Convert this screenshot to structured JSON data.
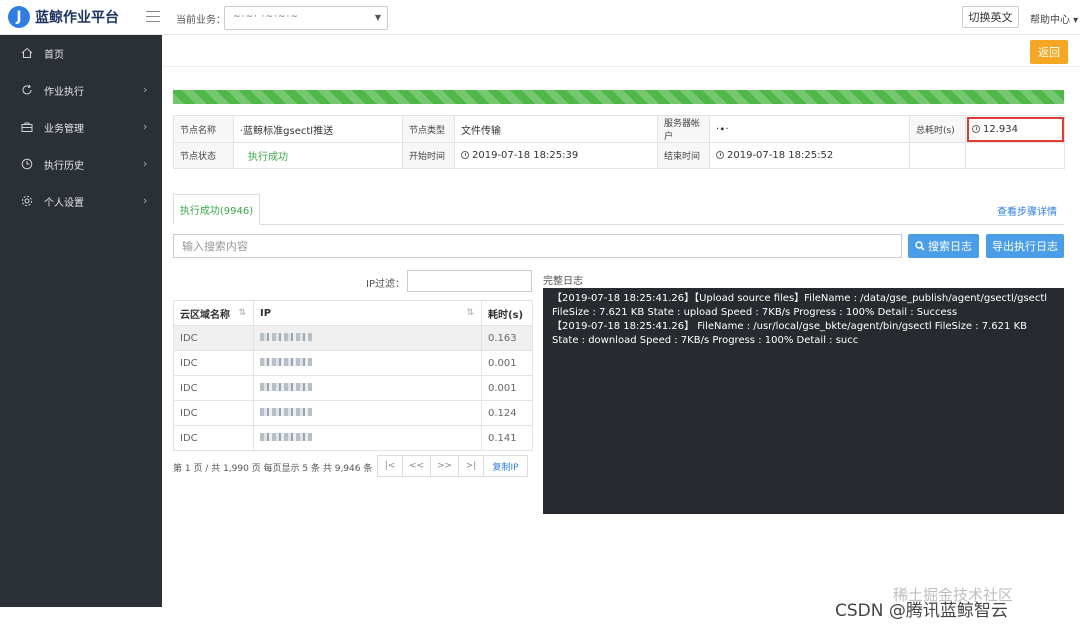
{
  "app": {
    "logo_letter": "J",
    "title": "蓝鲸作业平台"
  },
  "topbar": {
    "business_label": "当前业务：",
    "business_value": "~·~· ·~·~·~",
    "lang_button": "切换英文",
    "help": "帮助中心 ▾"
  },
  "sidebar": {
    "items": [
      {
        "label": "首页",
        "icon": "home-icon",
        "has_arrow": false
      },
      {
        "label": "作业执行",
        "icon": "refresh-icon",
        "has_arrow": true
      },
      {
        "label": "业务管理",
        "icon": "briefcase-icon",
        "has_arrow": true
      },
      {
        "label": "执行历史",
        "icon": "clock-icon",
        "has_arrow": true
      },
      {
        "label": "个人设置",
        "icon": "gear-icon",
        "has_arrow": true
      }
    ],
    "arrow": "›"
  },
  "main": {
    "back_button": "返回",
    "progress": 1.0,
    "info": {
      "node_name_label": "节点名称",
      "node_name_value": "·蓝鲸标准gsectl推送",
      "node_type_label": "节点类型",
      "node_type_value": "文件传输",
      "server_account_label": "服务器帐户",
      "server_account_value": "·∙·",
      "total_time_label": "总耗时(s)",
      "total_time_value": "12.934",
      "node_status_label": "节点状态",
      "node_status_value": "执行成功",
      "start_time_label": "开始时间",
      "start_time_value": "2019-07-18 18:25:39",
      "end_time_label": "结束时间",
      "end_time_value": "2019-07-18 18:25:52"
    },
    "tab_label": "执行成功(9946)",
    "view_steps_link": "查看步骤详情",
    "search_placeholder": "输入搜索内容",
    "search_button": "搜索日志",
    "export_button": "导出执行日志",
    "ip_filter_label": "IP过滤：",
    "hosts_table": {
      "columns": [
        "云区域名称",
        "IP",
        "耗时(s)"
      ],
      "rows": [
        {
          "zone": "IDC",
          "time": "0.163"
        },
        {
          "zone": "IDC",
          "time": "0.001"
        },
        {
          "zone": "IDC",
          "time": "0.001"
        },
        {
          "zone": "IDC",
          "time": "0.124"
        },
        {
          "zone": "IDC",
          "time": "0.141"
        }
      ]
    },
    "pager_info": "第 1 页 / 共 1,990 页  每页显示 5 条  共 9,946 条",
    "pager_buttons": [
      "|<",
      "<<",
      ">>",
      ">|",
      "复制IP"
    ],
    "log_title": "完整日志",
    "log_lines": [
      "【2019-07-18 18:25:41.26】【Upload source files】FileName : /data/gse_publish/agent/gsectl/gsectl  FileSize : 7.621 KB  State : upload  Speed : 7KB/s  Progress : 100%  Detail : Success",
      "【2019-07-18 18:25:41.26】 FileName : /usr/local/gse_bkte/agent/bin/gsectl  FileSize : 7.621 KB  State : download  Speed : 7KB/s  Progress : 100%  Detail : succ"
    ]
  },
  "watermark": {
    "line1": "稀土掘金技术社区",
    "line2": "CSDN @腾讯蓝鲸智云"
  },
  "colors": {
    "sidebar_bg": "#2b3036",
    "accent_green": "#4fb848",
    "accent_blue": "#4a9ee8",
    "back_orange": "#f5a623",
    "highlight_red": "#e53935"
  }
}
